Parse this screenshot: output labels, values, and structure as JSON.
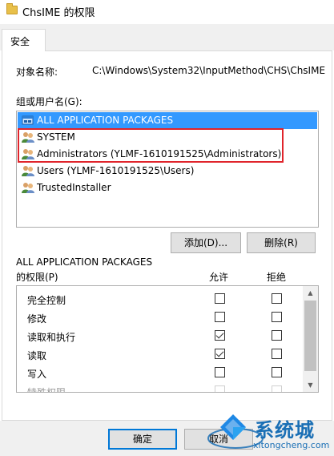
{
  "window": {
    "title": "ChsIME 的权限"
  },
  "tabs": [
    {
      "label": "安全"
    }
  ],
  "object": {
    "label": "对象名称:",
    "path": "C:\\Windows\\System32\\InputMethod\\CHS\\ChsIME"
  },
  "groups": {
    "label": "组或用户名(G):",
    "items": [
      {
        "label": "ALL APPLICATION PACKAGES",
        "icon": "app-packages-icon",
        "selected": true
      },
      {
        "label": "SYSTEM",
        "icon": "users-group-icon",
        "selected": false
      },
      {
        "label": "Administrators (YLMF-1610191525\\Administrators)",
        "icon": "users-group-icon",
        "selected": false
      },
      {
        "label": "Users (YLMF-1610191525\\Users)",
        "icon": "users-group-icon",
        "selected": false
      },
      {
        "label": "TrustedInstaller",
        "icon": "users-group-icon",
        "selected": false
      }
    ],
    "highlight_color": "#e0242b"
  },
  "buttons": {
    "add": "添加(D)...",
    "remove": "删除(R)",
    "ok": "确定",
    "cancel": "取消"
  },
  "permissions": {
    "header_line1": "ALL APPLICATION PACKAGES",
    "header_line2": "的权限(P)",
    "allow": "允许",
    "deny": "拒绝",
    "rows": [
      {
        "name": "完全控制",
        "allow": false,
        "deny": false
      },
      {
        "name": "修改",
        "allow": false,
        "deny": false
      },
      {
        "name": "读取和执行",
        "allow": true,
        "deny": false
      },
      {
        "name": "读取",
        "allow": true,
        "deny": false
      },
      {
        "name": "写入",
        "allow": false,
        "deny": false
      },
      {
        "name": "特殊权限",
        "allow": false,
        "deny": false
      }
    ]
  },
  "watermark": {
    "text": "系统城",
    "url": "xitongcheng.com"
  },
  "colors": {
    "selection": "#3399ff",
    "accent": "#0078d7",
    "watermark": "#1a6fb5"
  }
}
